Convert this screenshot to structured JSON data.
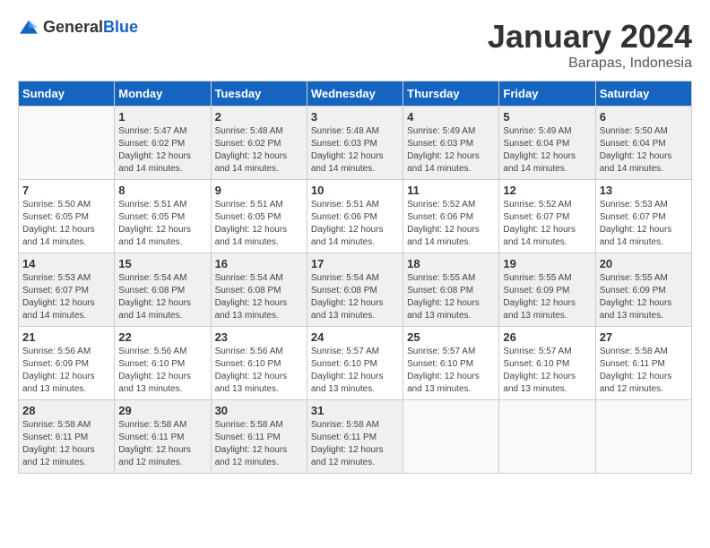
{
  "logo": {
    "text_general": "General",
    "text_blue": "Blue"
  },
  "header": {
    "title": "January 2024",
    "subtitle": "Barapas, Indonesia"
  },
  "weekdays": [
    "Sunday",
    "Monday",
    "Tuesday",
    "Wednesday",
    "Thursday",
    "Friday",
    "Saturday"
  ],
  "weeks": [
    [
      {
        "day": "",
        "info": ""
      },
      {
        "day": "1",
        "info": "Sunrise: 5:47 AM\nSunset: 6:02 PM\nDaylight: 12 hours\nand 14 minutes."
      },
      {
        "day": "2",
        "info": "Sunrise: 5:48 AM\nSunset: 6:02 PM\nDaylight: 12 hours\nand 14 minutes."
      },
      {
        "day": "3",
        "info": "Sunrise: 5:48 AM\nSunset: 6:03 PM\nDaylight: 12 hours\nand 14 minutes."
      },
      {
        "day": "4",
        "info": "Sunrise: 5:49 AM\nSunset: 6:03 PM\nDaylight: 12 hours\nand 14 minutes."
      },
      {
        "day": "5",
        "info": "Sunrise: 5:49 AM\nSunset: 6:04 PM\nDaylight: 12 hours\nand 14 minutes."
      },
      {
        "day": "6",
        "info": "Sunrise: 5:50 AM\nSunset: 6:04 PM\nDaylight: 12 hours\nand 14 minutes."
      }
    ],
    [
      {
        "day": "7",
        "info": "Sunrise: 5:50 AM\nSunset: 6:05 PM\nDaylight: 12 hours\nand 14 minutes."
      },
      {
        "day": "8",
        "info": "Sunrise: 5:51 AM\nSunset: 6:05 PM\nDaylight: 12 hours\nand 14 minutes."
      },
      {
        "day": "9",
        "info": "Sunrise: 5:51 AM\nSunset: 6:05 PM\nDaylight: 12 hours\nand 14 minutes."
      },
      {
        "day": "10",
        "info": "Sunrise: 5:51 AM\nSunset: 6:06 PM\nDaylight: 12 hours\nand 14 minutes."
      },
      {
        "day": "11",
        "info": "Sunrise: 5:52 AM\nSunset: 6:06 PM\nDaylight: 12 hours\nand 14 minutes."
      },
      {
        "day": "12",
        "info": "Sunrise: 5:52 AM\nSunset: 6:07 PM\nDaylight: 12 hours\nand 14 minutes."
      },
      {
        "day": "13",
        "info": "Sunrise: 5:53 AM\nSunset: 6:07 PM\nDaylight: 12 hours\nand 14 minutes."
      }
    ],
    [
      {
        "day": "14",
        "info": "Sunrise: 5:53 AM\nSunset: 6:07 PM\nDaylight: 12 hours\nand 14 minutes."
      },
      {
        "day": "15",
        "info": "Sunrise: 5:54 AM\nSunset: 6:08 PM\nDaylight: 12 hours\nand 14 minutes."
      },
      {
        "day": "16",
        "info": "Sunrise: 5:54 AM\nSunset: 6:08 PM\nDaylight: 12 hours\nand 13 minutes."
      },
      {
        "day": "17",
        "info": "Sunrise: 5:54 AM\nSunset: 6:08 PM\nDaylight: 12 hours\nand 13 minutes."
      },
      {
        "day": "18",
        "info": "Sunrise: 5:55 AM\nSunset: 6:08 PM\nDaylight: 12 hours\nand 13 minutes."
      },
      {
        "day": "19",
        "info": "Sunrise: 5:55 AM\nSunset: 6:09 PM\nDaylight: 12 hours\nand 13 minutes."
      },
      {
        "day": "20",
        "info": "Sunrise: 5:55 AM\nSunset: 6:09 PM\nDaylight: 12 hours\nand 13 minutes."
      }
    ],
    [
      {
        "day": "21",
        "info": "Sunrise: 5:56 AM\nSunset: 6:09 PM\nDaylight: 12 hours\nand 13 minutes."
      },
      {
        "day": "22",
        "info": "Sunrise: 5:56 AM\nSunset: 6:10 PM\nDaylight: 12 hours\nand 13 minutes."
      },
      {
        "day": "23",
        "info": "Sunrise: 5:56 AM\nSunset: 6:10 PM\nDaylight: 12 hours\nand 13 minutes."
      },
      {
        "day": "24",
        "info": "Sunrise: 5:57 AM\nSunset: 6:10 PM\nDaylight: 12 hours\nand 13 minutes."
      },
      {
        "day": "25",
        "info": "Sunrise: 5:57 AM\nSunset: 6:10 PM\nDaylight: 12 hours\nand 13 minutes."
      },
      {
        "day": "26",
        "info": "Sunrise: 5:57 AM\nSunset: 6:10 PM\nDaylight: 12 hours\nand 13 minutes."
      },
      {
        "day": "27",
        "info": "Sunrise: 5:58 AM\nSunset: 6:11 PM\nDaylight: 12 hours\nand 12 minutes."
      }
    ],
    [
      {
        "day": "28",
        "info": "Sunrise: 5:58 AM\nSunset: 6:11 PM\nDaylight: 12 hours\nand 12 minutes."
      },
      {
        "day": "29",
        "info": "Sunrise: 5:58 AM\nSunset: 6:11 PM\nDaylight: 12 hours\nand 12 minutes."
      },
      {
        "day": "30",
        "info": "Sunrise: 5:58 AM\nSunset: 6:11 PM\nDaylight: 12 hours\nand 12 minutes."
      },
      {
        "day": "31",
        "info": "Sunrise: 5:58 AM\nSunset: 6:11 PM\nDaylight: 12 hours\nand 12 minutes."
      },
      {
        "day": "",
        "info": ""
      },
      {
        "day": "",
        "info": ""
      },
      {
        "day": "",
        "info": ""
      }
    ]
  ]
}
